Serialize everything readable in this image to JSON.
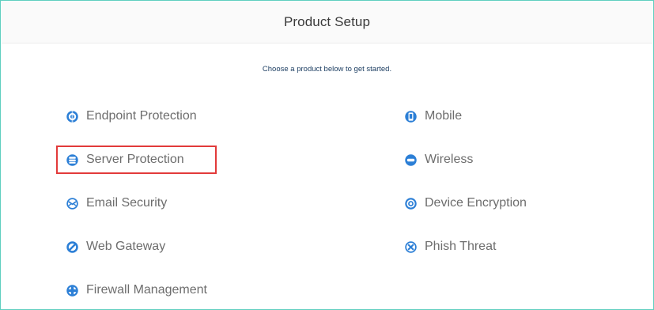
{
  "header": {
    "title": "Product Setup"
  },
  "subtitle": "Choose a product below to get started.",
  "accent_color": "#2c7fd6",
  "highlight_color": "#e23a3a",
  "products_left": [
    {
      "label": "Endpoint Protection",
      "icon": "endpoint-icon"
    },
    {
      "label": "Server Protection",
      "icon": "server-icon",
      "highlighted": true
    },
    {
      "label": "Email Security",
      "icon": "email-icon"
    },
    {
      "label": "Web Gateway",
      "icon": "web-gateway-icon"
    },
    {
      "label": "Firewall Management",
      "icon": "firewall-icon"
    }
  ],
  "products_right": [
    {
      "label": "Mobile",
      "icon": "mobile-icon"
    },
    {
      "label": "Wireless",
      "icon": "wireless-icon"
    },
    {
      "label": "Device Encryption",
      "icon": "encryption-icon"
    },
    {
      "label": "Phish Threat",
      "icon": "phish-threat-icon"
    }
  ]
}
